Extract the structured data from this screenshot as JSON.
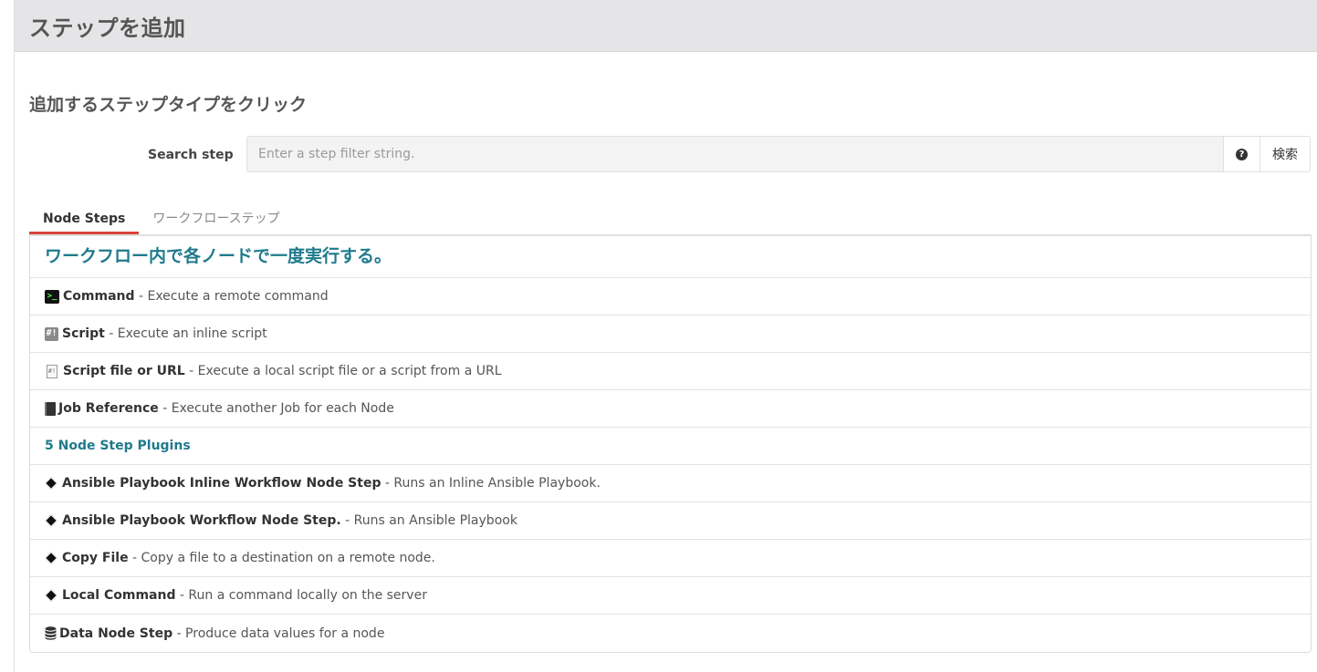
{
  "modal": {
    "title": "ステップを追加"
  },
  "subtitle": "追加するステップタイプをクリック",
  "search": {
    "label": "Search step",
    "placeholder": "Enter a step filter string.",
    "help_icon": "question-circle-icon",
    "button_label": "検索"
  },
  "tabs": [
    {
      "label": "Node Steps",
      "active": true
    },
    {
      "label": "ワークフローステップ",
      "active": false
    }
  ],
  "list": {
    "heading": "ワークフロー内で各ノードで一度実行する。",
    "items": [
      {
        "icon": "terminal-icon",
        "name": "Command",
        "desc": " - Execute a remote command"
      },
      {
        "icon": "script-icon",
        "name": "Script",
        "desc": " - Execute an inline script"
      },
      {
        "icon": "script-file-icon",
        "name": "Script file or URL",
        "desc": " - Execute a local script file or a script from a URL"
      },
      {
        "icon": "book-icon",
        "name": "Job Reference",
        "desc": " - Execute another Job for each Node"
      }
    ],
    "plugins_label": "5 Node Step Plugins",
    "plugins": [
      {
        "icon": "diamond-icon",
        "name": "Ansible Playbook Inline Workflow Node Step",
        "desc": " - Runs an Inline Ansible Playbook."
      },
      {
        "icon": "diamond-icon",
        "name": "Ansible Playbook Workflow Node Step.",
        "desc": " - Runs an Ansible Playbook"
      },
      {
        "icon": "diamond-icon",
        "name": "Copy File",
        "desc": " - Copy a file to a destination on a remote node."
      },
      {
        "icon": "diamond-icon",
        "name": "Local Command",
        "desc": " - Run a command locally on the server"
      },
      {
        "icon": "database-icon",
        "name": "Data Node Step",
        "desc": " - Produce data values for a node"
      }
    ]
  },
  "colors": {
    "accent_teal": "#1f7a8c",
    "tab_active_underline": "#d9433b",
    "header_bg": "#e5e5e7"
  }
}
